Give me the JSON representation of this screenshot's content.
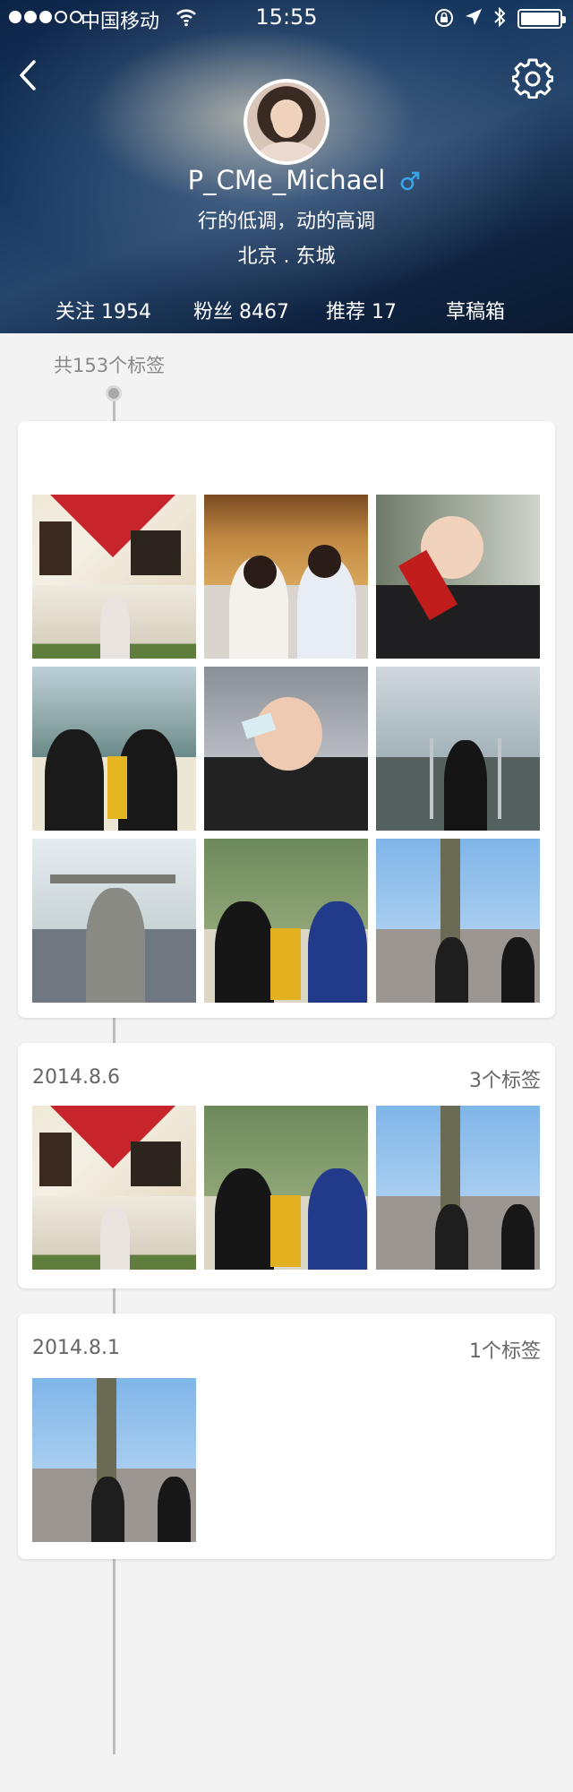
{
  "status_bar": {
    "carrier": "中国移动",
    "time": "15:55",
    "signal_bars_on": 3,
    "signal_bars_total": 5,
    "battery_level": 1.0
  },
  "header": {
    "username": "P_CMe_Michael",
    "motto": "行的低调，动的高调",
    "location": "北京 . 东城",
    "gender_icon": "male-icon",
    "gender_color": "#3aa4e8",
    "stats": {
      "following": "关注 1954",
      "fans": "粉丝 8467",
      "recommend": "推荐 17",
      "drafts": "草稿箱"
    }
  },
  "timeline": {
    "count_label": "共153个标签",
    "cards": [
      {
        "date": "",
        "count": "",
        "photos": 9
      },
      {
        "date": "2014.8.6",
        "count": "3个标签",
        "photos": 3
      },
      {
        "date": "2014.8.1",
        "count": "1个标签",
        "photos": 1
      }
    ]
  },
  "colors": {
    "background": "#f3f3f3",
    "card": "#ffffff",
    "timeline": "#bdbdbd",
    "muted_text": "#888888"
  }
}
